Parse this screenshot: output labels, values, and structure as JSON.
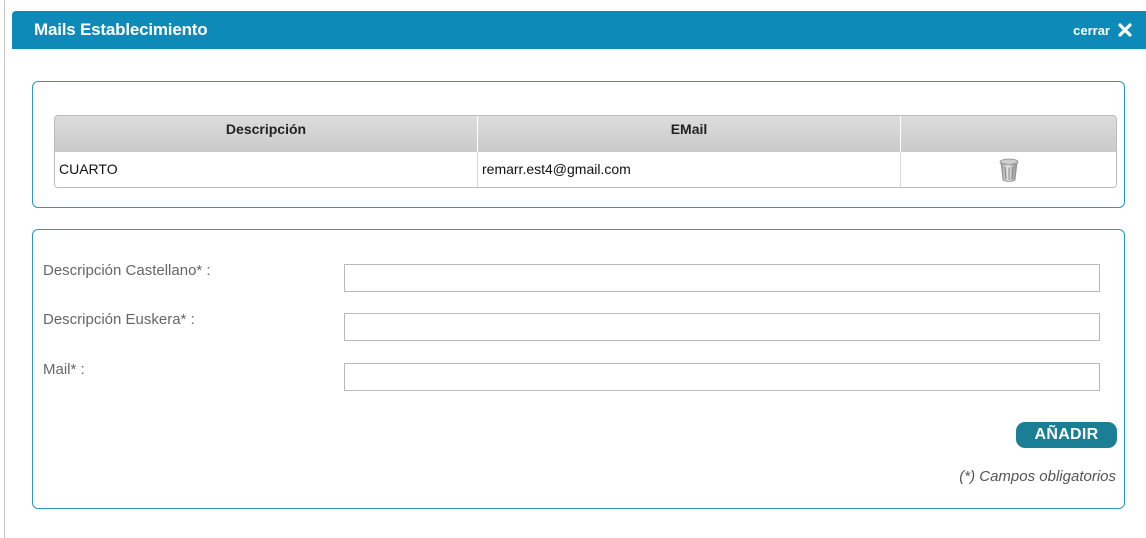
{
  "dialog": {
    "title": "Mails Establecimiento",
    "close_label": "cerrar"
  },
  "table": {
    "columns": [
      "Descripción",
      "EMail",
      ""
    ],
    "rows": [
      {
        "descripcion": "CUARTO",
        "email": "remarr.est4@gmail.com",
        "action_icon": "trash-icon"
      }
    ]
  },
  "form": {
    "desc_castellano_label": "Descripción Castellano* :",
    "desc_castellano_value": "",
    "desc_euskera_label": "Descripción Euskera* :",
    "desc_euskera_value": "",
    "mail_label": "Mail* :",
    "mail_value": "",
    "add_button": "AÑADIR",
    "required_note": "(*) Campos obligatorios"
  },
  "colors": {
    "titlebar": "#0e8ab8",
    "panel_border": "#2a98c3",
    "button": "#1a7f94"
  }
}
